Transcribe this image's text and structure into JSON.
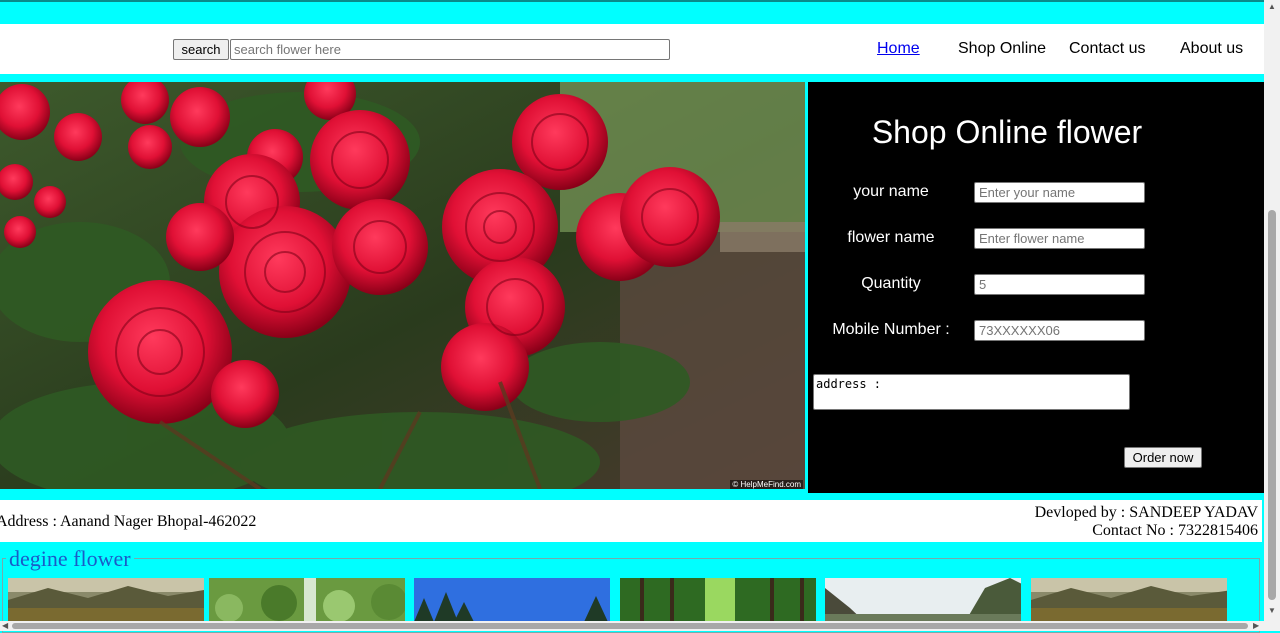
{
  "header": {
    "search_button": "search",
    "search_placeholder": "search flower here",
    "nav": [
      {
        "label": "Home",
        "active": true
      },
      {
        "label": "Shop Online"
      },
      {
        "label": "Contact us"
      },
      {
        "label": "About us"
      }
    ]
  },
  "hero": {
    "image": "red-roses-bush-photo",
    "watermark": "© HelpMeFind.com"
  },
  "order_form": {
    "title": "Shop Online flower",
    "fields": [
      {
        "label": "your name",
        "placeholder": "Enter your name"
      },
      {
        "label": "flower name",
        "placeholder": "Enter flower name"
      },
      {
        "label": "Quantity",
        "placeholder": "5"
      },
      {
        "label": "Mobile Number :",
        "placeholder": "73XXXXXX06"
      }
    ],
    "address_value": "address :",
    "order_button": "Order now"
  },
  "footer": {
    "address": "Address : Aanand Nager Bhopal-462022",
    "developer": "Devloped by : SANDEEP YADAV",
    "contact": "Contact No : 7322815406"
  },
  "gallery": {
    "legend": "degine flower",
    "thumbnails": [
      "valley-landscape-photo",
      "mossy-waterfall-photo",
      "pine-forest-sky-photo",
      "green-forest-path-photo",
      "rocky-mountains-photo",
      "valley-landscape-photo"
    ]
  },
  "colors": {
    "page_bg": "#00ffff",
    "panel_bg": "#000000",
    "legend": "#1a5bc8",
    "active_link": "#0000ee"
  }
}
